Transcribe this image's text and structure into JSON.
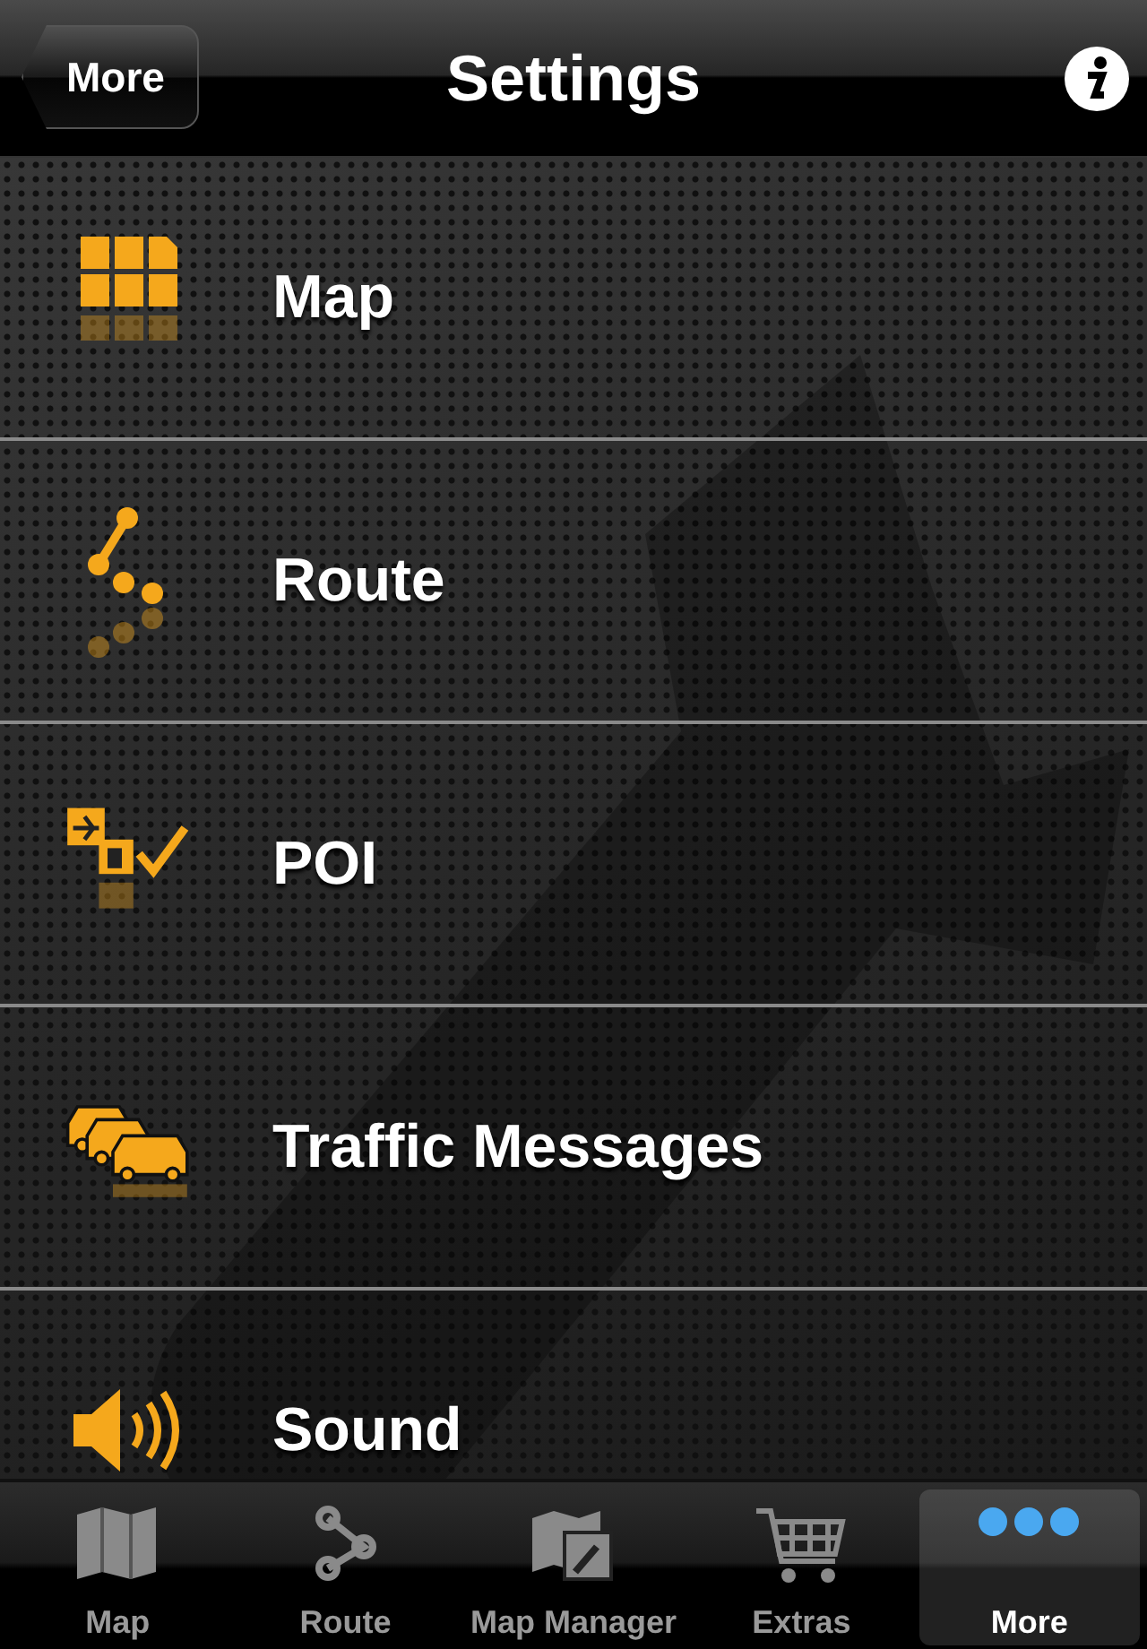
{
  "nav_bar": {
    "back_button": "More",
    "title": "Settings"
  },
  "settings": [
    {
      "kind": "map",
      "label": "Map"
    },
    {
      "kind": "route",
      "label": "Route"
    },
    {
      "kind": "poi",
      "label": "POI"
    },
    {
      "kind": "traffic",
      "label": "Traffic Messages"
    },
    {
      "kind": "sound",
      "label": "Sound"
    }
  ],
  "tab_bar": [
    {
      "kind": "map",
      "label": "Map",
      "selected": false
    },
    {
      "kind": "route",
      "label": "Route",
      "selected": false
    },
    {
      "kind": "manager",
      "label": "Map Manager",
      "selected": false
    },
    {
      "kind": "extras",
      "label": "Extras",
      "selected": false
    },
    {
      "kind": "more",
      "label": "More",
      "selected": true
    }
  ]
}
